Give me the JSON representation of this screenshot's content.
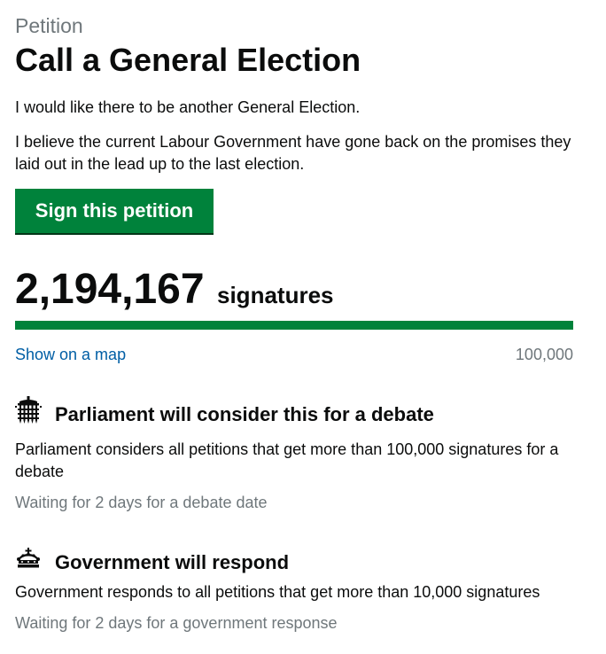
{
  "petition": {
    "kicker": "Petition",
    "title": "Call a General Election",
    "summary": "I would like there to be another General Election.",
    "details": "I believe the current Labour Government have gone back on the promises they laid out in the lead up to the last election.",
    "sign_button_label": "Sign this petition"
  },
  "signatures": {
    "count": "2,194,167",
    "label": "signatures",
    "progress_fraction": 1.0,
    "map_link": "Show on a map",
    "threshold": "100,000"
  },
  "debate": {
    "icon": "portcullis-icon",
    "title": "Parliament will consider this for a debate",
    "description": "Parliament considers all petitions that get more than 100,000 signatures for a debate",
    "status": "Waiting for 2 days for a debate date"
  },
  "government": {
    "icon": "crown-icon",
    "title": "Government will respond",
    "description": "Government responds to all petitions that get more than 10,000 signatures",
    "status": "Waiting for 2 days for a government response"
  },
  "colors": {
    "brand_green": "#00823b",
    "link_blue": "#005ea5",
    "secondary_text": "#6f777b",
    "text": "#0b0c0c"
  }
}
